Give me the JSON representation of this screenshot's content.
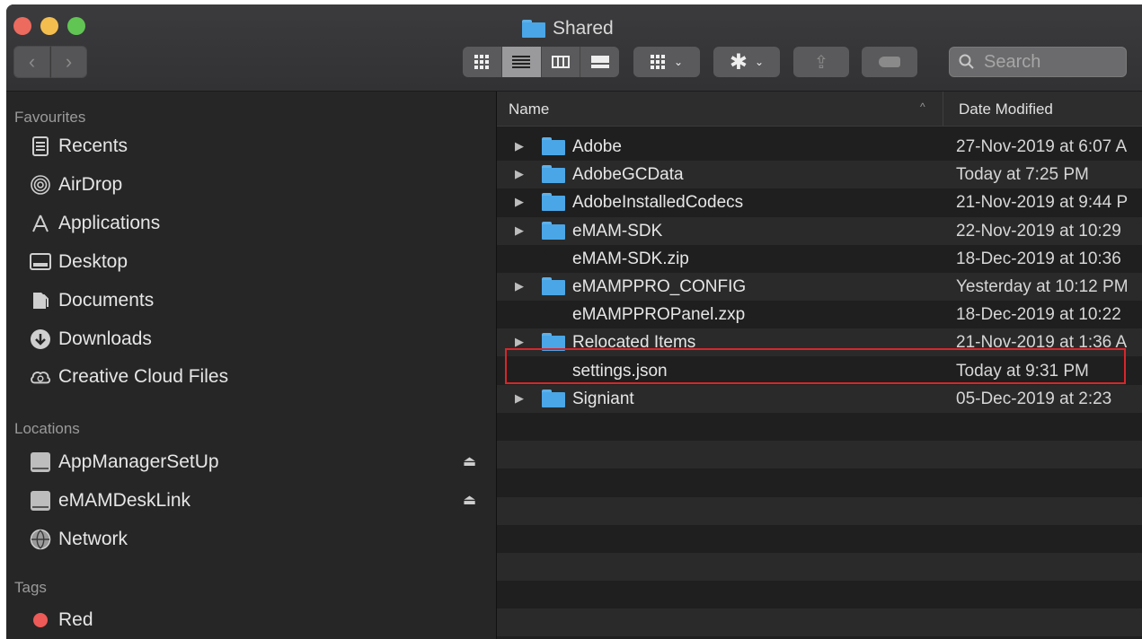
{
  "window": {
    "title": "Shared",
    "search": {
      "placeholder": "Search",
      "value": ""
    }
  },
  "toolbar": {
    "back_label": "‹",
    "forward_label": "›",
    "gear_glyph": "✱",
    "chevron": "⌄",
    "share_glyph": "⇪"
  },
  "sidebar": {
    "favourites_heading": "Favourites",
    "favourites": [
      {
        "label": "Recents",
        "icon": "recents-icon"
      },
      {
        "label": "AirDrop",
        "icon": "airdrop-icon"
      },
      {
        "label": "Applications",
        "icon": "applications-icon"
      },
      {
        "label": "Desktop",
        "icon": "desktop-icon"
      },
      {
        "label": "Documents",
        "icon": "documents-icon"
      },
      {
        "label": "Downloads",
        "icon": "downloads-icon"
      },
      {
        "label": "Creative Cloud Files",
        "icon": "creative-cloud-icon"
      }
    ],
    "locations_heading": "Locations",
    "locations": [
      {
        "label": "AppManagerSetUp",
        "icon": "drive-icon",
        "eject": "⏏"
      },
      {
        "label": "eMAMDeskLink",
        "icon": "drive-icon",
        "eject": "⏏"
      },
      {
        "label": "Network",
        "icon": "network-icon"
      }
    ],
    "tags_heading": "Tags",
    "tags": [
      {
        "label": "Red",
        "color": "#ed5a57"
      }
    ]
  },
  "columns": {
    "name": "Name",
    "date_modified": "Date Modified",
    "sort_indicator": "^"
  },
  "files": [
    {
      "name": "Adobe",
      "date": "27-Nov-2019 at 6:07 A",
      "kind": "folder"
    },
    {
      "name": "AdobeGCData",
      "date": "Today at 7:25 PM",
      "kind": "folder"
    },
    {
      "name": "AdobeInstalledCodecs",
      "date": "21-Nov-2019 at 9:44 P",
      "kind": "folder"
    },
    {
      "name": "eMAM-SDK",
      "date": "22-Nov-2019 at 10:29",
      "kind": "folder"
    },
    {
      "name": "eMAM-SDK.zip",
      "date": "18-Dec-2019 at 10:36",
      "kind": "zip"
    },
    {
      "name": "eMAMPPRO_CONFIG",
      "date": "Yesterday at 10:12 PM",
      "kind": "folder"
    },
    {
      "name": "eMAMPPROPanel.zxp",
      "date": "18-Dec-2019 at 10:22",
      "kind": "file"
    },
    {
      "name": "Relocated Items",
      "date": "21-Nov-2019 at 1:36 A",
      "kind": "folder"
    },
    {
      "name": "settings.json",
      "date": "Today at 9:31 PM",
      "kind": "document",
      "highlighted": true
    },
    {
      "name": "Signiant",
      "date": "05-Dec-2019 at 2:23",
      "kind": "folder"
    }
  ],
  "colors": {
    "highlight_box": "#d8262b",
    "folder": "#4aa6e6",
    "sidebar_bg": "#262626"
  }
}
